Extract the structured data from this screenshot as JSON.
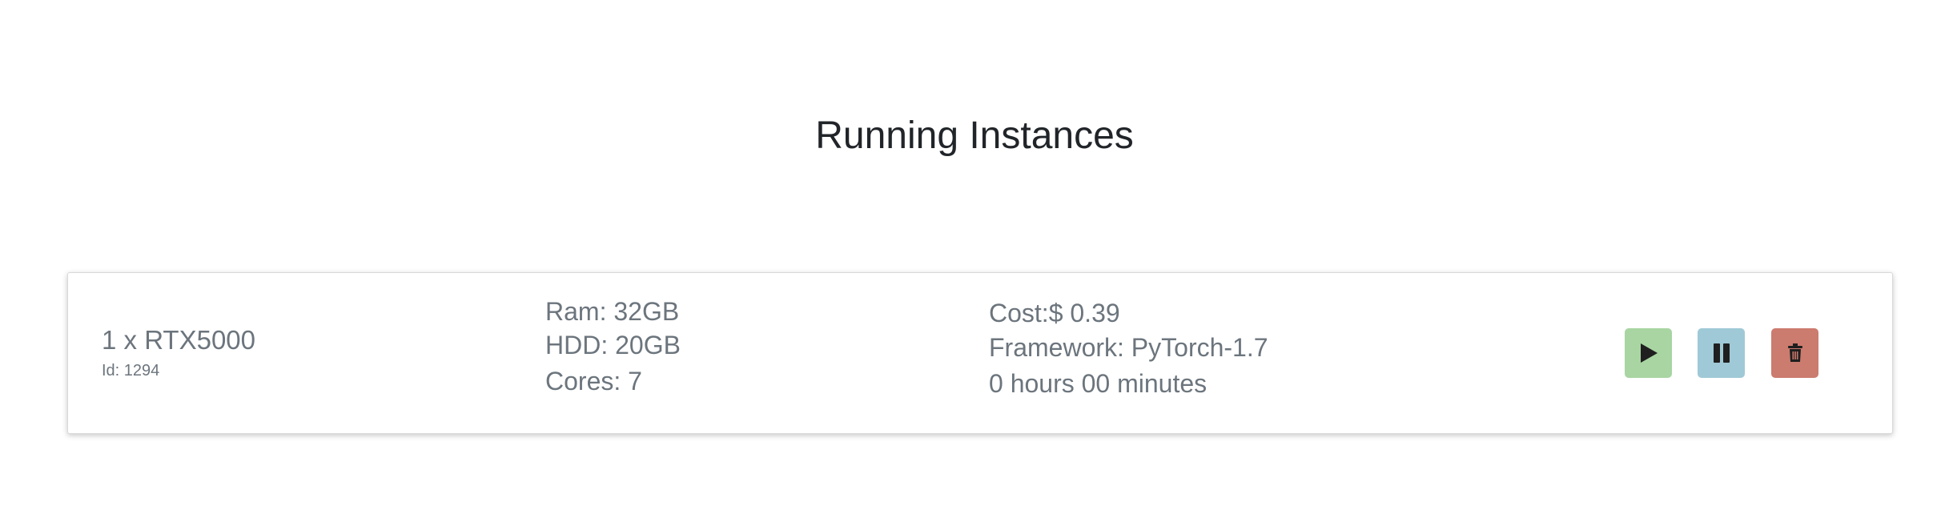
{
  "page": {
    "title": "Running Instances"
  },
  "instance": {
    "gpu": "1 x RTX5000",
    "id_label": "Id: 1294",
    "ram": "Ram: 32GB",
    "hdd": "HDD: 20GB",
    "cores": "Cores: 7",
    "cost": "Cost:$ 0.39",
    "framework": "Framework: PyTorch-1.7",
    "uptime": "0 hours 00 minutes"
  },
  "actions": {
    "start_icon": "play-icon",
    "pause_icon": "pause-icon",
    "delete_icon": "trash-icon"
  },
  "colors": {
    "start": "#a8d5a2",
    "pause": "#9fc9d6",
    "delete": "#cc7b6f",
    "text": "#6c757d",
    "title": "#212529"
  }
}
